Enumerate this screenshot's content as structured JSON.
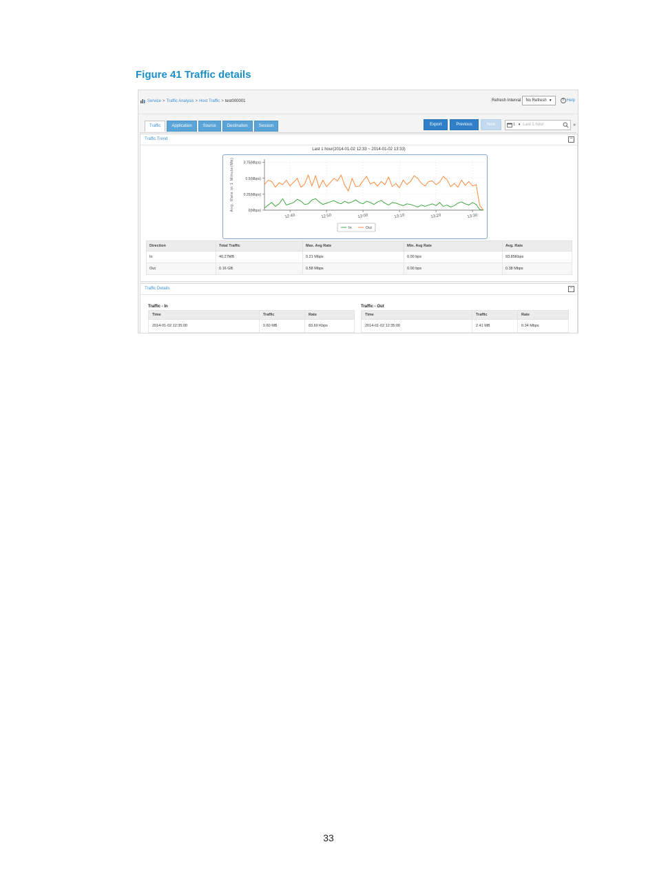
{
  "figure": {
    "title": "Figure 41 Traffic details",
    "page_number": "33"
  },
  "breadcrumb": {
    "items": [
      "Service",
      "Traffic Analysis",
      "Host Traffic"
    ],
    "separator": ">",
    "current": "test000001"
  },
  "refresh": {
    "label": "Refresh Interval",
    "value": "No Refresh",
    "help": "Help"
  },
  "tabs": [
    "Traffic",
    "Application",
    "Source",
    "Destination",
    "Session"
  ],
  "actions": {
    "export": "Export",
    "previous": "Previous",
    "next": "Next"
  },
  "time_range": {
    "value": "1",
    "placeholder": "Last 1 hour"
  },
  "trend_panel": {
    "title": "Traffic Trend"
  },
  "chart_data": {
    "type": "line",
    "title": "Last 1 hour(2014-01-02 12:33 ~ 2014-01-02 13:33)",
    "ylabel": "Avg. Rate in 1 Minute(Mb)",
    "yticks": [
      "0(Mbps)",
      "0.25(Mbps)",
      "0.5(Mbps)",
      "0.75(Mbps)"
    ],
    "ylim": [
      0,
      0.8
    ],
    "xticks": [
      "12:40",
      "12:50",
      "13:00",
      "13:10",
      "13:20",
      "13:30"
    ],
    "xlim": [
      0,
      60
    ],
    "grid": true,
    "legend_position": "bottom-center",
    "series": [
      {
        "name": "In",
        "color": "#2ca02c",
        "values": [
          0.03,
          0.08,
          0.12,
          0.06,
          0.1,
          0.18,
          0.08,
          0.1,
          0.12,
          0.17,
          0.14,
          0.09,
          0.1,
          0.16,
          0.18,
          0.13,
          0.09,
          0.11,
          0.13,
          0.15,
          0.12,
          0.1,
          0.14,
          0.11,
          0.13,
          0.16,
          0.12,
          0.1,
          0.14,
          0.12,
          0.09,
          0.13,
          0.15,
          0.11,
          0.08,
          0.12,
          0.11,
          0.09,
          0.07,
          0.1,
          0.09,
          0.07,
          0.05,
          0.08,
          0.06,
          0.08,
          0.1,
          0.07,
          0.12,
          0.06,
          0.08,
          0.05,
          0.07,
          0.11,
          0.13,
          0.1,
          0.08,
          0.12,
          0.09,
          0.01,
          0.0
        ]
      },
      {
        "name": "Out",
        "color": "#ff7f2a",
        "values": [
          0.4,
          0.47,
          0.45,
          0.36,
          0.43,
          0.4,
          0.47,
          0.38,
          0.44,
          0.5,
          0.36,
          0.41,
          0.55,
          0.38,
          0.54,
          0.35,
          0.47,
          0.37,
          0.43,
          0.5,
          0.46,
          0.55,
          0.39,
          0.3,
          0.5,
          0.37,
          0.38,
          0.46,
          0.53,
          0.41,
          0.44,
          0.38,
          0.45,
          0.4,
          0.52,
          0.37,
          0.42,
          0.35,
          0.47,
          0.4,
          0.45,
          0.54,
          0.5,
          0.42,
          0.38,
          0.45,
          0.46,
          0.4,
          0.44,
          0.53,
          0.48,
          0.37,
          0.42,
          0.36,
          0.47,
          0.39,
          0.45,
          0.38,
          0.4,
          0.07,
          0.0
        ]
      }
    ]
  },
  "summary": {
    "headers": [
      "Direction",
      "Total Traffic",
      "Max. Avg Rate",
      "Min. Avg Rate",
      "Avg. Rate"
    ],
    "rows": [
      [
        "In",
        "40.27MB",
        "0.21 Mbps",
        "0.00 bps",
        "93.85Kbps"
      ],
      [
        "Out",
        "0.16 GB",
        "0.58 Mbps",
        "0.00 bps",
        "0.38 Mbps"
      ]
    ]
  },
  "details_panel": {
    "title": "Traffic Details"
  },
  "details_in": {
    "title": "Traffic - In",
    "headers": [
      "Time",
      "Traffic",
      "Rate"
    ],
    "rows": [
      [
        "2014-01-02 12:35:00",
        "0.60 MB",
        "83.60 Kbps"
      ]
    ]
  },
  "details_out": {
    "title": "Traffic - Out",
    "headers": [
      "Time",
      "Traffic",
      "Rate"
    ],
    "rows": [
      [
        "2014-01-02 12:35:00",
        "2.41 MB",
        "0.34 Mbps"
      ]
    ]
  }
}
